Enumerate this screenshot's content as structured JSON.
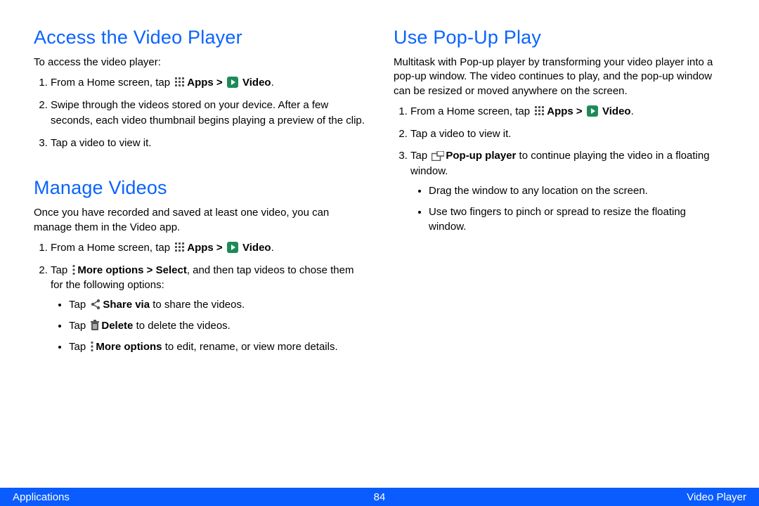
{
  "left": {
    "section1": {
      "heading": "Access the Video Player",
      "intro": "To access the video player:",
      "items": {
        "i1_pre": "From a Home screen, tap ",
        "i1_apps": "Apps > ",
        "i1_video": "Video",
        "i1_post": ".",
        "i2": "Swipe through the videos stored on your device. After a few seconds, each video thumbnail begins playing a preview of the clip.",
        "i3": "Tap a video to view it."
      }
    },
    "section2": {
      "heading": "Manage Videos",
      "intro": "Once you have recorded and saved at least one video, you can manage them in the Video app.",
      "items": {
        "i1_pre": "From a Home screen, tap ",
        "i1_apps": "Apps > ",
        "i1_video": "Video",
        "i1_post": ".",
        "i2_pre": "Tap ",
        "i2_more": "More options > Select",
        "i2_post": ", and then tap videos to chose them for the following options:",
        "b1_pre": "Tap ",
        "b1_bold": "Share via",
        "b1_post": " to share the videos.",
        "b2_pre": "Tap ",
        "b2_bold": "Delete ",
        "b2_post": " to delete the videos.",
        "b3_pre": "Tap ",
        "b3_bold": "More options",
        "b3_post": " to edit, rename, or view more details."
      }
    }
  },
  "right": {
    "section1": {
      "heading": "Use Pop-Up Play",
      "intro": "Multitask with Pop-up player by transforming your video player into a pop-up window. The video continues to play, and the pop-up window can be resized or moved anywhere on the screen.",
      "items": {
        "i1_pre": "From a Home screen, tap ",
        "i1_apps": "Apps > ",
        "i1_video": "Video",
        "i1_post": ".",
        "i2": "Tap a video to view it.",
        "i3_pre": "Tap ",
        "i3_bold": "Pop-up player",
        "i3_post": " to continue playing the video in a floating window.",
        "b1": "Drag the window to any location on the screen.",
        "b2": "Use two fingers to pinch or spread to resize the floating window."
      }
    }
  },
  "footer": {
    "left": "Applications",
    "center": "84",
    "right": "Video Player"
  }
}
